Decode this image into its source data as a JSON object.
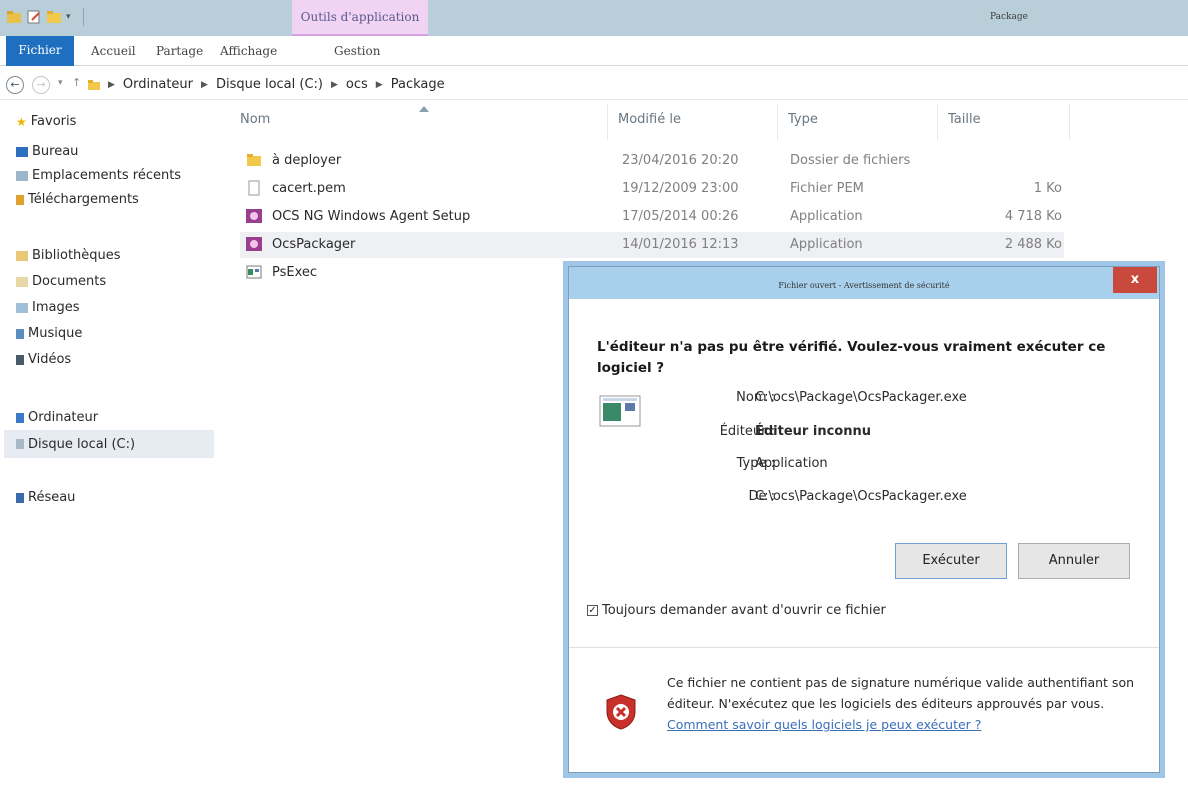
{
  "window": {
    "title": "Package",
    "context_tab": "Outils d'application"
  },
  "ribbon": {
    "tabs": [
      "Fichier",
      "Accueil",
      "Partage",
      "Affichage",
      "Gestion"
    ]
  },
  "breadcrumbs": [
    "Ordinateur",
    "Disque local (C:)",
    "ocs",
    "Package"
  ],
  "navpane": {
    "favorites": [
      "Favoris",
      "Bureau",
      "Emplacements récents",
      "Téléchargements"
    ],
    "libraries": [
      "Bibliothèques",
      "Documents",
      "Images",
      "Musique",
      "Vidéos"
    ],
    "computer": [
      "Ordinateur",
      "Disque local (C:)"
    ],
    "network": "Réseau"
  },
  "filelist": {
    "columns": [
      "Nom",
      "Modifié le",
      "Type",
      "Taille"
    ],
    "rows": [
      {
        "name": "à deployer",
        "date": "23/04/2016 20:20",
        "type": "Dossier de fichiers",
        "size": "",
        "icon": "folder-icon"
      },
      {
        "name": "cacert.pem",
        "date": "19/12/2009 23:00",
        "type": "Fichier PEM",
        "size": "1 Ko",
        "icon": "file-icon"
      },
      {
        "name": "OCS NG Windows Agent Setup",
        "date": "17/05/2014 00:26",
        "type": "Application",
        "size": "4 718 Ko",
        "icon": "setup-icon"
      },
      {
        "name": "OcsPackager",
        "date": "14/01/2016 12:13",
        "type": "Application",
        "size": "2 488 Ko",
        "icon": "setup-icon"
      },
      {
        "name": "PsExec",
        "date": "",
        "type": "",
        "size": "",
        "icon": "exe-icon"
      }
    ]
  },
  "dialog": {
    "title": "Fichier ouvert - Avertissement de sécurité",
    "close": "x",
    "heading": "L'éditeur n'a pas pu être vérifié. Voulez-vous vraiment exécuter ce logiciel ?",
    "fields": [
      {
        "label": "Nom :",
        "value": "C:\\ocs\\Package\\OcsPackager.exe"
      },
      {
        "label": "Éditeur :",
        "value": "Éditeur inconnu"
      },
      {
        "label": "Type :",
        "value": "Application"
      },
      {
        "label": "De :",
        "value": "C:\\ocs\\Package\\OcsPackager.exe"
      }
    ],
    "run_button": "Exécuter",
    "cancel_button": "Annuler",
    "checkbox_label": "Toujours demander avant d'ouvrir ce fichier",
    "checkbox_checked": true,
    "footer_text": "Ce fichier ne contient pas de signature numérique valide authentifiant son éditeur. N'exécutez que les logiciels des éditeurs approuvés par vous.",
    "footer_link": "Comment savoir quels logiciels je peux exécuter ?"
  },
  "colors": {
    "titlebar": "#b8cfd9",
    "context_tab": "#f1d3f3",
    "file_tab": "#1e6fbf",
    "dialog_frame": "#9fc6e6",
    "close_button": "#c9493c",
    "link": "#3a6fb8"
  }
}
